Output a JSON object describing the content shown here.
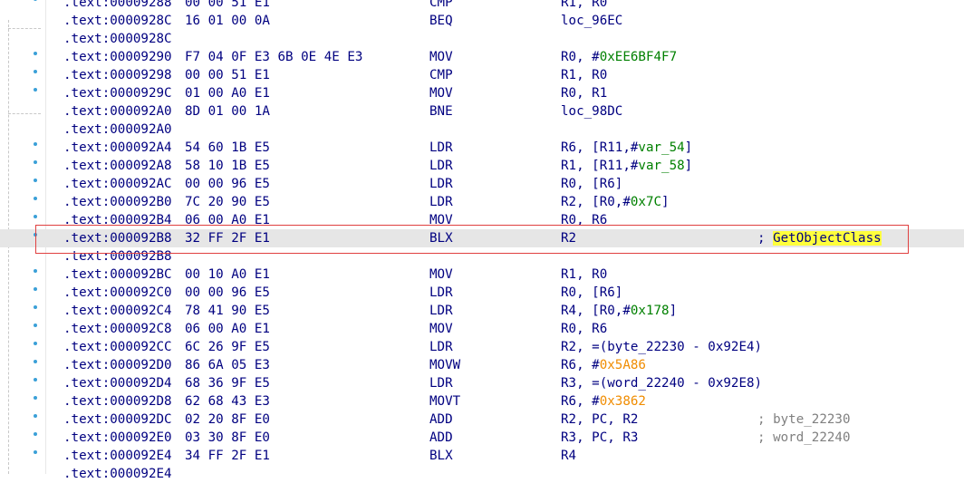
{
  "listing": [
    {
      "addr": ".text:00009288",
      "bytes": "00 00 51 E1",
      "mnemonic": "CMP",
      "operands": [
        {
          "t": "R1, R0",
          "k": "p"
        }
      ],
      "comment": "",
      "dot": true
    },
    {
      "addr": ".text:0000928C",
      "bytes": "16 01 00 0A",
      "mnemonic": "BEQ",
      "operands": [
        {
          "t": "loc_96EC",
          "k": "p"
        }
      ],
      "comment": "",
      "dot": false
    },
    {
      "addr": ".text:0000928C",
      "bytes": "",
      "mnemonic": "",
      "operands": [],
      "comment": "",
      "dot": false
    },
    {
      "addr": ".text:00009290",
      "bytes": "F7 04 0F E3 6B 0E 4E E3",
      "mnemonic": "MOV",
      "operands": [
        {
          "t": "R0, #",
          "k": "p"
        },
        {
          "t": "0xEE6BF4F7",
          "k": "n"
        }
      ],
      "comment": "",
      "dot": true
    },
    {
      "addr": ".text:00009298",
      "bytes": "00 00 51 E1",
      "mnemonic": "CMP",
      "operands": [
        {
          "t": "R1, R0",
          "k": "p"
        }
      ],
      "comment": "",
      "dot": true
    },
    {
      "addr": ".text:0000929C",
      "bytes": "01 00 A0 E1",
      "mnemonic": "MOV",
      "operands": [
        {
          "t": "R0, R1",
          "k": "p"
        }
      ],
      "comment": "",
      "dot": true
    },
    {
      "addr": ".text:000092A0",
      "bytes": "8D 01 00 1A",
      "mnemonic": "BNE",
      "operands": [
        {
          "t": "loc_98DC",
          "k": "p"
        }
      ],
      "comment": "",
      "dot": false
    },
    {
      "addr": ".text:000092A0",
      "bytes": "",
      "mnemonic": "",
      "operands": [],
      "comment": "",
      "dot": false
    },
    {
      "addr": ".text:000092A4",
      "bytes": "54 60 1B E5",
      "mnemonic": "LDR",
      "operands": [
        {
          "t": "R6, [R11,#",
          "k": "p"
        },
        {
          "t": "var_54",
          "k": "v"
        },
        {
          "t": "]",
          "k": "p"
        }
      ],
      "comment": "",
      "dot": true
    },
    {
      "addr": ".text:000092A8",
      "bytes": "58 10 1B E5",
      "mnemonic": "LDR",
      "operands": [
        {
          "t": "R1, [R11,#",
          "k": "p"
        },
        {
          "t": "var_58",
          "k": "v"
        },
        {
          "t": "]",
          "k": "p"
        }
      ],
      "comment": "",
      "dot": true
    },
    {
      "addr": ".text:000092AC",
      "bytes": "00 00 96 E5",
      "mnemonic": "LDR",
      "operands": [
        {
          "t": "R0, [R6]",
          "k": "p"
        }
      ],
      "comment": "",
      "dot": true
    },
    {
      "addr": ".text:000092B0",
      "bytes": "7C 20 90 E5",
      "mnemonic": "LDR",
      "operands": [
        {
          "t": "R2, [R0,#",
          "k": "p"
        },
        {
          "t": "0x7C",
          "k": "n"
        },
        {
          "t": "]",
          "k": "p"
        }
      ],
      "comment": "",
      "dot": true
    },
    {
      "addr": ".text:000092B4",
      "bytes": "06 00 A0 E1",
      "mnemonic": "MOV",
      "operands": [
        {
          "t": "R0, R6",
          "k": "p"
        }
      ],
      "comment": "",
      "dot": true
    },
    {
      "addr": ".text:000092B8",
      "bytes": "32 FF 2F E1",
      "mnemonic": "BLX",
      "operands": [
        {
          "t": "R2",
          "k": "p"
        }
      ],
      "comment": "GetObjectClass",
      "comment_highlight": true,
      "dot": true,
      "selected": true
    },
    {
      "addr": ".text:000092B8",
      "bytes": "",
      "mnemonic": "",
      "operands": [],
      "comment": "",
      "dot": false
    },
    {
      "addr": ".text:000092BC",
      "bytes": "00 10 A0 E1",
      "mnemonic": "MOV",
      "operands": [
        {
          "t": "R1, R0",
          "k": "p"
        }
      ],
      "comment": "",
      "dot": true
    },
    {
      "addr": ".text:000092C0",
      "bytes": "00 00 96 E5",
      "mnemonic": "LDR",
      "operands": [
        {
          "t": "R0, [R6]",
          "k": "p"
        }
      ],
      "comment": "",
      "dot": true
    },
    {
      "addr": ".text:000092C4",
      "bytes": "78 41 90 E5",
      "mnemonic": "LDR",
      "operands": [
        {
          "t": "R4, [R0,#",
          "k": "p"
        },
        {
          "t": "0x178",
          "k": "n"
        },
        {
          "t": "]",
          "k": "p"
        }
      ],
      "comment": "",
      "dot": true
    },
    {
      "addr": ".text:000092C8",
      "bytes": "06 00 A0 E1",
      "mnemonic": "MOV",
      "operands": [
        {
          "t": "R0, R6",
          "k": "p"
        }
      ],
      "comment": "",
      "dot": true
    },
    {
      "addr": ".text:000092CC",
      "bytes": "6C 26 9F E5",
      "mnemonic": "LDR",
      "operands": [
        {
          "t": "R2, =(byte_22230 - 0x92E4)",
          "k": "p"
        }
      ],
      "comment": "",
      "dot": true
    },
    {
      "addr": ".text:000092D0",
      "bytes": "86 6A 05 E3",
      "mnemonic": "MOVW",
      "operands": [
        {
          "t": "R6, #",
          "k": "p"
        },
        {
          "t": "0x5A86",
          "k": "o"
        }
      ],
      "comment": "",
      "dot": true
    },
    {
      "addr": ".text:000092D4",
      "bytes": "68 36 9F E5",
      "mnemonic": "LDR",
      "operands": [
        {
          "t": "R3, =(word_22240 - 0x92E8)",
          "k": "p"
        }
      ],
      "comment": "",
      "dot": true
    },
    {
      "addr": ".text:000092D8",
      "bytes": "62 68 43 E3",
      "mnemonic": "MOVT",
      "operands": [
        {
          "t": "R6, #",
          "k": "p"
        },
        {
          "t": "0x3862",
          "k": "o"
        }
      ],
      "comment": "",
      "dot": true
    },
    {
      "addr": ".text:000092DC",
      "bytes": "02 20 8F E0",
      "mnemonic": "ADD",
      "operands": [
        {
          "t": "R2, PC, R2",
          "k": "p"
        }
      ],
      "comment": "byte_22230",
      "dot": true
    },
    {
      "addr": ".text:000092E0",
      "bytes": "03 30 8F E0",
      "mnemonic": "ADD",
      "operands": [
        {
          "t": "R3, PC, R3",
          "k": "p"
        }
      ],
      "comment": "word_22240",
      "dot": true
    },
    {
      "addr": ".text:000092E4",
      "bytes": "34 FF 2F E1",
      "mnemonic": "BLX",
      "operands": [
        {
          "t": "R4",
          "k": "p"
        }
      ],
      "comment": "",
      "dot": true
    },
    {
      "addr": ".text:000092E4",
      "bytes": "",
      "mnemonic": "",
      "operands": [],
      "comment": "",
      "dot": false
    }
  ],
  "colors": {
    "text": "#000080",
    "number": "#008000",
    "immediate": "#f08c00",
    "comment": "#808080",
    "highlight": "#ffff3c",
    "selection_border": "#e04040"
  }
}
